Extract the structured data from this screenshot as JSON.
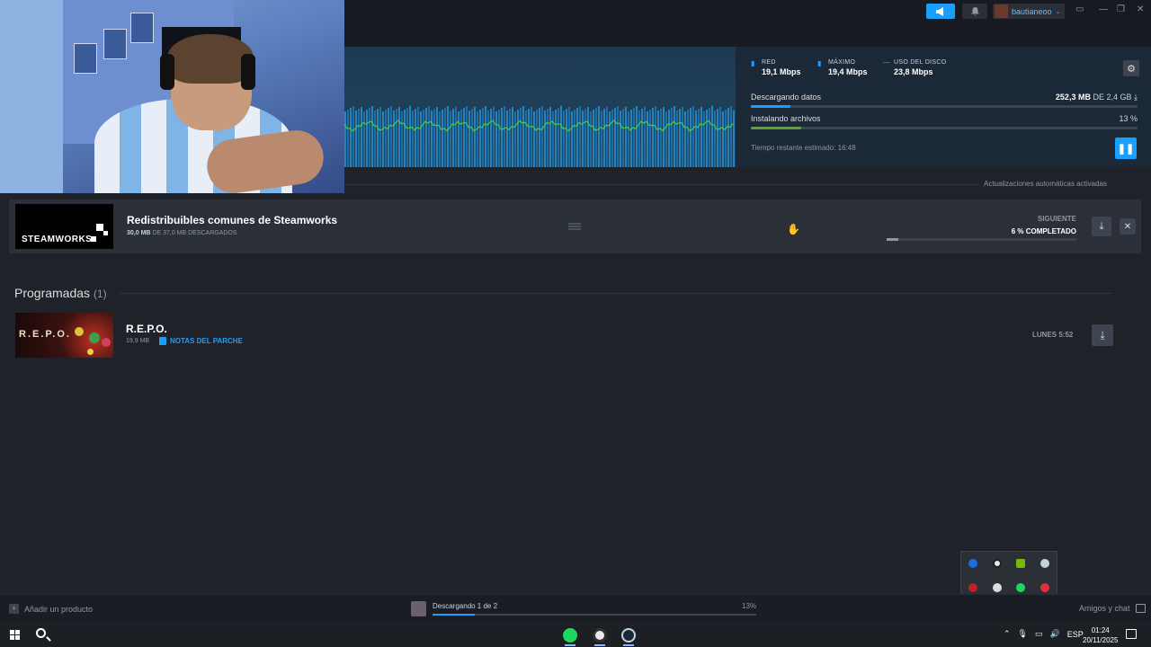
{
  "topbar": {
    "username": "bautianeoo",
    "caret": "⌄"
  },
  "stats": {
    "network": {
      "label": "RED",
      "value": "19,1 Mbps"
    },
    "peak": {
      "label": "MÁXIMO",
      "value": "19,4 Mbps"
    },
    "disk": {
      "label": "USO DEL DISCO",
      "value": "23,8 Mbps"
    }
  },
  "progress": {
    "downloading_label": "Descargando datos",
    "downloading_amount": "252,3 MB",
    "downloading_of": "DE 2,4 GB",
    "downloading_fraction": 0.103,
    "installing_label": "Instalando archivos",
    "installing_pct": "13 %",
    "installing_fraction": 0.13,
    "time_left": "Tiempo restante estimado: 16:48"
  },
  "auto_updates": "Actualizaciones automáticas activadas",
  "current_item": {
    "logo_text": "STEAMWORKS",
    "title": "Redistribuibles comunes de Steamworks",
    "size_done": "30,0 MB",
    "size_rest": "DE 37,0 MB DESCARGADOS",
    "next_label": "SIGUIENTE",
    "pct_label": "6 % COMPLETADO",
    "fraction": 0.06
  },
  "scheduled": {
    "heading": "Programadas",
    "count": "(1)",
    "item": {
      "logo_text": "R.E.P.O.",
      "title": "R.E.P.O.",
      "size": "19,9 MB",
      "notes": "NOTAS DEL PARCHE",
      "when": "LUNES 5:52"
    }
  },
  "bottombar": {
    "add_product": "Añadir un producto",
    "status": "Descargando 1 de 2",
    "pct": "13%",
    "fraction": 0.13,
    "friends": "Amigos y chat"
  },
  "taskbar": {
    "lang": "ESP",
    "time": "01:24",
    "date": "20/11/2025"
  },
  "colors": {
    "accent": "#1a9fff",
    "install_green": "#5ba32b",
    "graph_line": "#3fd13f"
  }
}
